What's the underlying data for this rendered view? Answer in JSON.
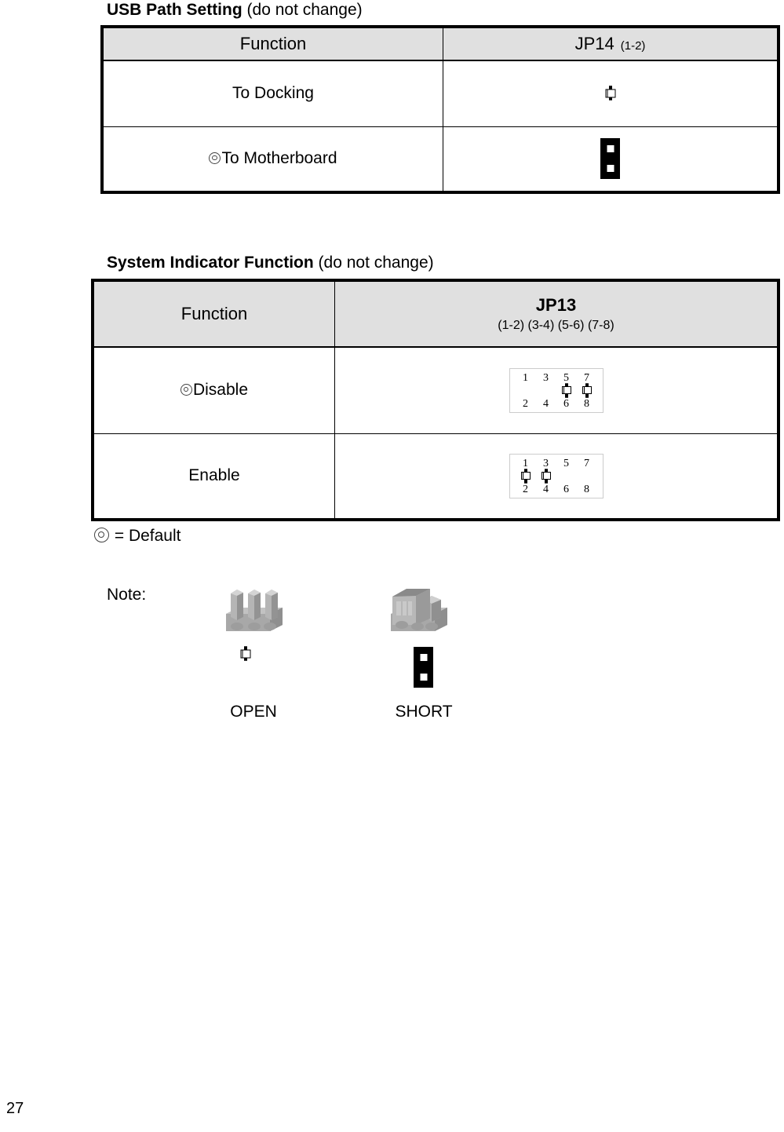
{
  "page": {
    "number": "27"
  },
  "usb_section": {
    "heading_bold": "USB Path Setting",
    "heading_note": " (do not change)",
    "table": {
      "columns": [
        {
          "label": "Function"
        },
        {
          "label": "JP14",
          "sub": "(1-2)"
        }
      ],
      "rows": [
        {
          "function": "To Docking",
          "is_default": false,
          "jumper": "open",
          "jumper_name": "jumper-open-2pin"
        },
        {
          "function": "To Motherboard",
          "is_default": true,
          "jumper": "short",
          "jumper_name": "jumper-short-2pin"
        }
      ]
    }
  },
  "indicator_section": {
    "heading_bold": "System Indicator Function",
    "heading_note": " (do not change)",
    "table": {
      "columns": [
        {
          "label": "Function"
        },
        {
          "label": "JP13",
          "sub": "(1-2) (3-4) (5-6) (7-8)"
        }
      ],
      "rows": [
        {
          "function": "Disable",
          "is_default": true,
          "top_pins": [
            "1",
            "3",
            "5",
            "7"
          ],
          "bottom_pins": [
            "2",
            "4",
            "6",
            "8"
          ],
          "pair_states": [
            "short",
            "short",
            "open",
            "open"
          ]
        },
        {
          "function": "Enable",
          "is_default": false,
          "top_pins": [
            "1",
            "3",
            "5",
            "7"
          ],
          "bottom_pins": [
            "2",
            "4",
            "6",
            "8"
          ],
          "pair_states": [
            "open",
            "open",
            "short",
            "short"
          ]
        }
      ]
    }
  },
  "legend": {
    "text": "= Default",
    "symbol": "bullseye"
  },
  "note": {
    "label": "Note:",
    "items": [
      {
        "caption": "OPEN",
        "glyph": "open",
        "header_icon": "pin-header-open-3d"
      },
      {
        "caption": "SHORT",
        "glyph": "short",
        "header_icon": "jumper-cap-3d"
      }
    ]
  }
}
